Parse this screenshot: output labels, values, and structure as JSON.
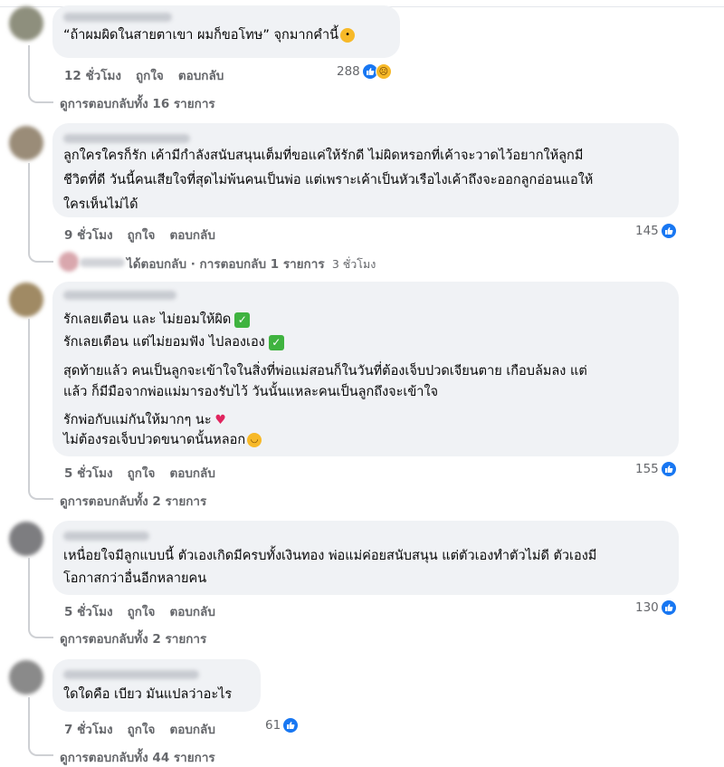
{
  "colors": {
    "like_blue": "#1877f2",
    "bubble_bg": "#f0f2f5",
    "meta_gray": "#65676b"
  },
  "comments": [
    {
      "lines": [
        "“ถ้าผมผิดในสายตาเขา ผมก็ขอโทษ” จุกมากคำนี้"
      ],
      "time": "12 ชั่วโมง",
      "like": "ถูกใจ",
      "reply": "ตอบกลับ",
      "reaction_count": "288",
      "reactions": [
        "like-icon",
        "sad-icon"
      ],
      "replies_label": "ดูการตอบกลับทั้ง 16 รายการ"
    },
    {
      "lines": [
        "ลูกใครใครก็รัก เค้ามีกำลังสนับสนุนเต็มที่ขอแค่ให้รักดี ไม่ผิดหรอกที่เค้าจะวาดไว้อยากให้ลูกมี",
        "ชีวิตที่ดี วันนี้คนเสียใจที่สุดไม่พ้นคนเป็นพ่อ แต่เพราะเค้าเป็นหัวเรือไงเค้าถึงจะออกลูกอ่อนแอให้",
        "ใครเห็นไม่ได้"
      ],
      "time": "9 ชั่วโมง",
      "like": "ถูกใจ",
      "reply": "ตอบกลับ",
      "reaction_count": "145",
      "reactions": [
        "like-icon"
      ],
      "reply_preview_action": "ได้ตอบกลับ",
      "reply_preview_rest": " · การตอบกลับ 1 รายการ",
      "reply_preview_time": "3 ชั่วโมง"
    },
    {
      "paragraphs": [
        [
          "รักเลยเตือน และ ไม่ยอมให้ผิด",
          "รักเลยเตือน แต่ไม่ยอมฟัง ไปลองเอง"
        ],
        [
          "สุดท้ายแล้ว คนเป็นลูกจะเข้าใจในสิ่งที่พ่อแม่สอนก็ในวันที่ต้องเจ็บปวดเจียนตาย เกือบล้มลง แต่",
          "แล้ว ก็มีมือจากพ่อแม่มารองรับไว้ วันนั้นแหละคนเป็นลูกถึงจะเข้าใจ"
        ],
        [
          "รักพ่อกับแม่กันให้มากๆ นะ",
          "ไม่ต้องรอเจ็บปวดขนาดนั้นหลอก"
        ]
      ],
      "time": "5 ชั่วโมง",
      "like": "ถูกใจ",
      "reply": "ตอบกลับ",
      "reaction_count": "155",
      "reactions": [
        "like-icon"
      ],
      "replies_label": "ดูการตอบกลับทั้ง 2 รายการ"
    },
    {
      "lines": [
        "เหนื่อยใจมีลูกแบบนี้ ตัวเองเกิดมีครบทั้งเงินทอง พ่อแม่ค่อยสนับสนุน แต่ตัวเองทำตัวไม่ดี ตัวเองมี",
        "โอกาสกว่าอื่นอีกหลายคน"
      ],
      "time": "5 ชั่วโมง",
      "like": "ถูกใจ",
      "reply": "ตอบกลับ",
      "reaction_count": "130",
      "reactions": [
        "like-icon"
      ],
      "replies_label": "ดูการตอบกลับทั้ง 2 รายการ"
    },
    {
      "lines": [
        "ใดใดคือ เบียว มันแปลว่าอะไร"
      ],
      "time": "7 ชั่วโมง",
      "like": "ถูกใจ",
      "reply": "ตอบกลับ",
      "reaction_count": "61",
      "reactions": [
        "like-icon"
      ],
      "replies_label": "ดูการตอบกลับทั้ง 44 รายการ"
    }
  ]
}
